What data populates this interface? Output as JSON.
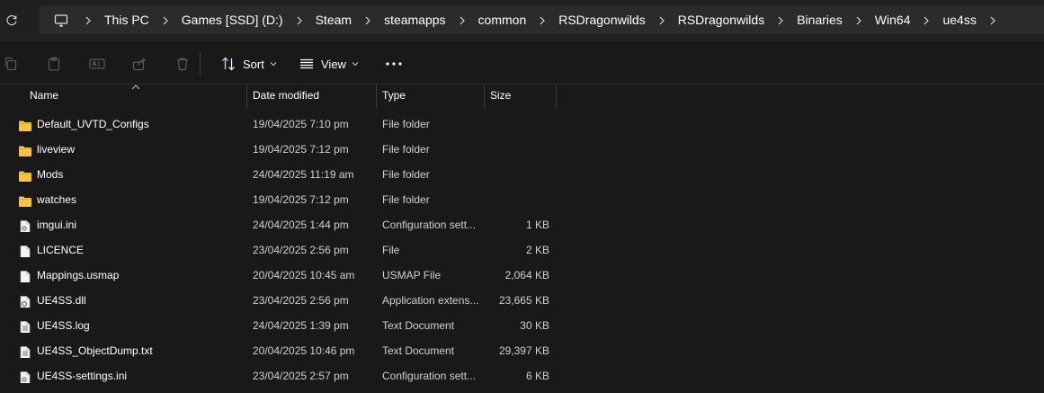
{
  "breadcrumb": [
    "This PC",
    "Games [SSD] (D:)",
    "Steam",
    "steamapps",
    "common",
    "RSDragonwilds",
    "RSDragonwilds",
    "Binaries",
    "Win64",
    "ue4ss"
  ],
  "toolbar": {
    "sort_label": "Sort",
    "view_label": "View"
  },
  "columns": {
    "name": "Name",
    "date": "Date modified",
    "type": "Type",
    "size": "Size"
  },
  "files": [
    {
      "icon": "folder",
      "name": "Default_UVTD_Configs",
      "date": "19/04/2025 7:10 pm",
      "type": "File folder",
      "size": ""
    },
    {
      "icon": "folder",
      "name": "liveview",
      "date": "19/04/2025 7:12 pm",
      "type": "File folder",
      "size": ""
    },
    {
      "icon": "folder",
      "name": "Mods",
      "date": "24/04/2025 11:19 am",
      "type": "File folder",
      "size": ""
    },
    {
      "icon": "folder",
      "name": "watches",
      "date": "19/04/2025 7:12 pm",
      "type": "File folder",
      "size": ""
    },
    {
      "icon": "settings-file",
      "name": "imgui.ini",
      "date": "24/04/2025 1:44 pm",
      "type": "Configuration sett...",
      "size": "1 KB"
    },
    {
      "icon": "file",
      "name": "LICENCE",
      "date": "23/04/2025 2:56 pm",
      "type": "File",
      "size": "2 KB"
    },
    {
      "icon": "file",
      "name": "Mappings.usmap",
      "date": "20/04/2025 10:45 am",
      "type": "USMAP File",
      "size": "2,064 KB"
    },
    {
      "icon": "dll-file",
      "name": "UE4SS.dll",
      "date": "23/04/2025 2:56 pm",
      "type": "Application extens...",
      "size": "23,665 KB"
    },
    {
      "icon": "text-file",
      "name": "UE4SS.log",
      "date": "24/04/2025 1:39 pm",
      "type": "Text Document",
      "size": "30 KB"
    },
    {
      "icon": "text-file",
      "name": "UE4SS_ObjectDump.txt",
      "date": "20/04/2025 10:46 pm",
      "type": "Text Document",
      "size": "29,397 KB"
    },
    {
      "icon": "settings-file",
      "name": "UE4SS-settings.ini",
      "date": "23/04/2025 2:57 pm",
      "type": "Configuration sett...",
      "size": "6 KB"
    }
  ],
  "colors": {
    "folder": "#f6c445",
    "background": "#191919",
    "addressbar": "#2b2b2b"
  }
}
